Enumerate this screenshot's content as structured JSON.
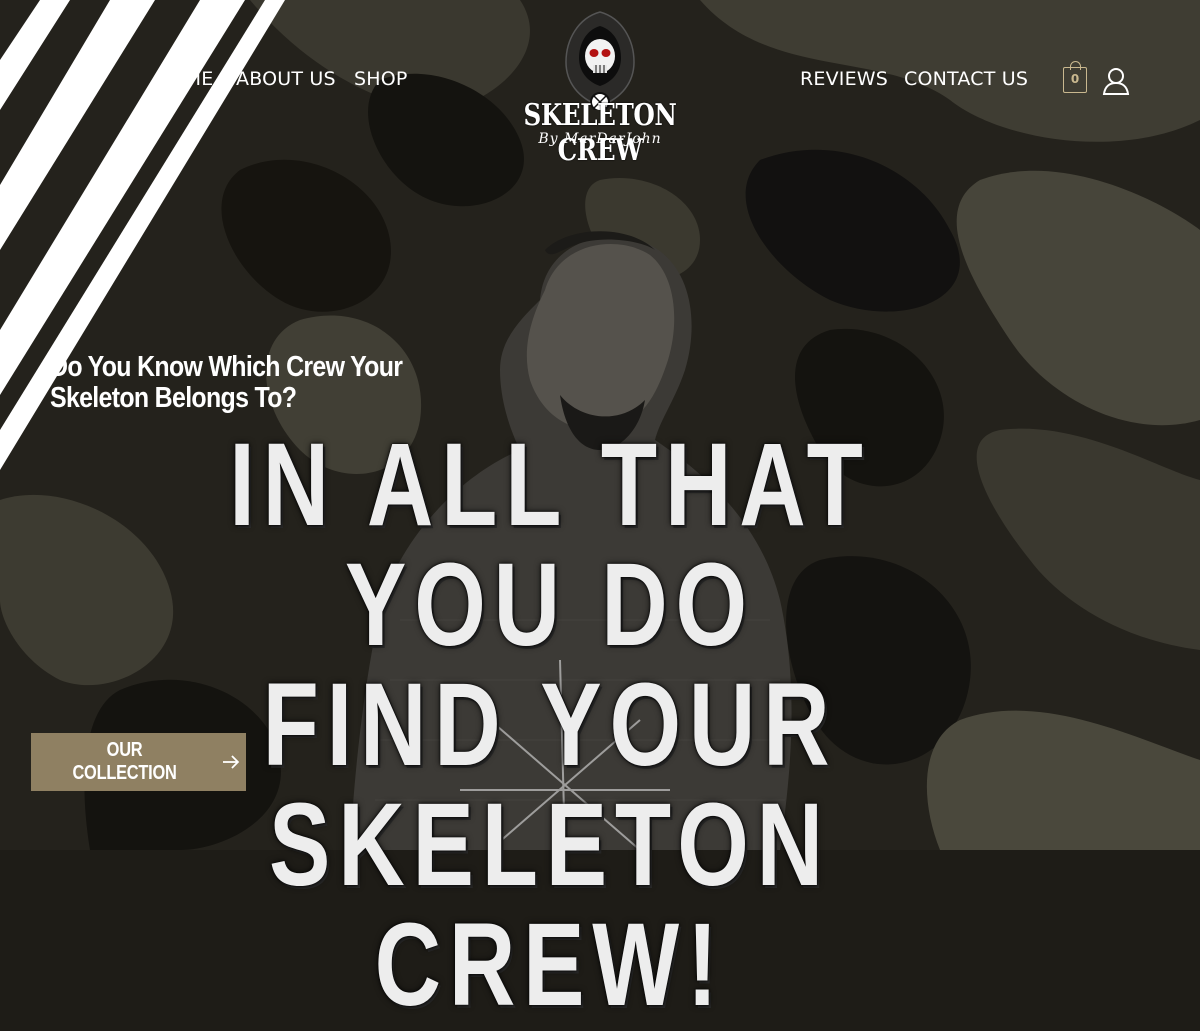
{
  "header": {
    "nav_left": [
      {
        "label": "HOME"
      },
      {
        "label": "ABOUT US"
      },
      {
        "label": "SHOP"
      }
    ],
    "nav_right": [
      {
        "label": "REVIEWS"
      },
      {
        "label": "CONTACT US"
      }
    ],
    "logo": {
      "title": "SKELETON CREW",
      "subtitle": "By MarDarJohn",
      "icon": "hooded-skull-icon"
    },
    "cart": {
      "count": "0",
      "icon": "shopping-bag-icon"
    },
    "account": {
      "icon": "user-icon"
    }
  },
  "hero": {
    "tagline": "Do You Know Which Crew Your Skeleton Belongs To?",
    "headline_lines": [
      "IN ALL THAT YOU DO",
      "FIND YOUR SKELETON",
      "CREW!"
    ],
    "cta": {
      "label": "OUR COLLECTION",
      "icon": "arrow-right-icon"
    }
  },
  "colors": {
    "accent": "#8f8062",
    "cart_outline": "#c9b88f",
    "text": "#ffffff",
    "background": "#1e1c17"
  }
}
